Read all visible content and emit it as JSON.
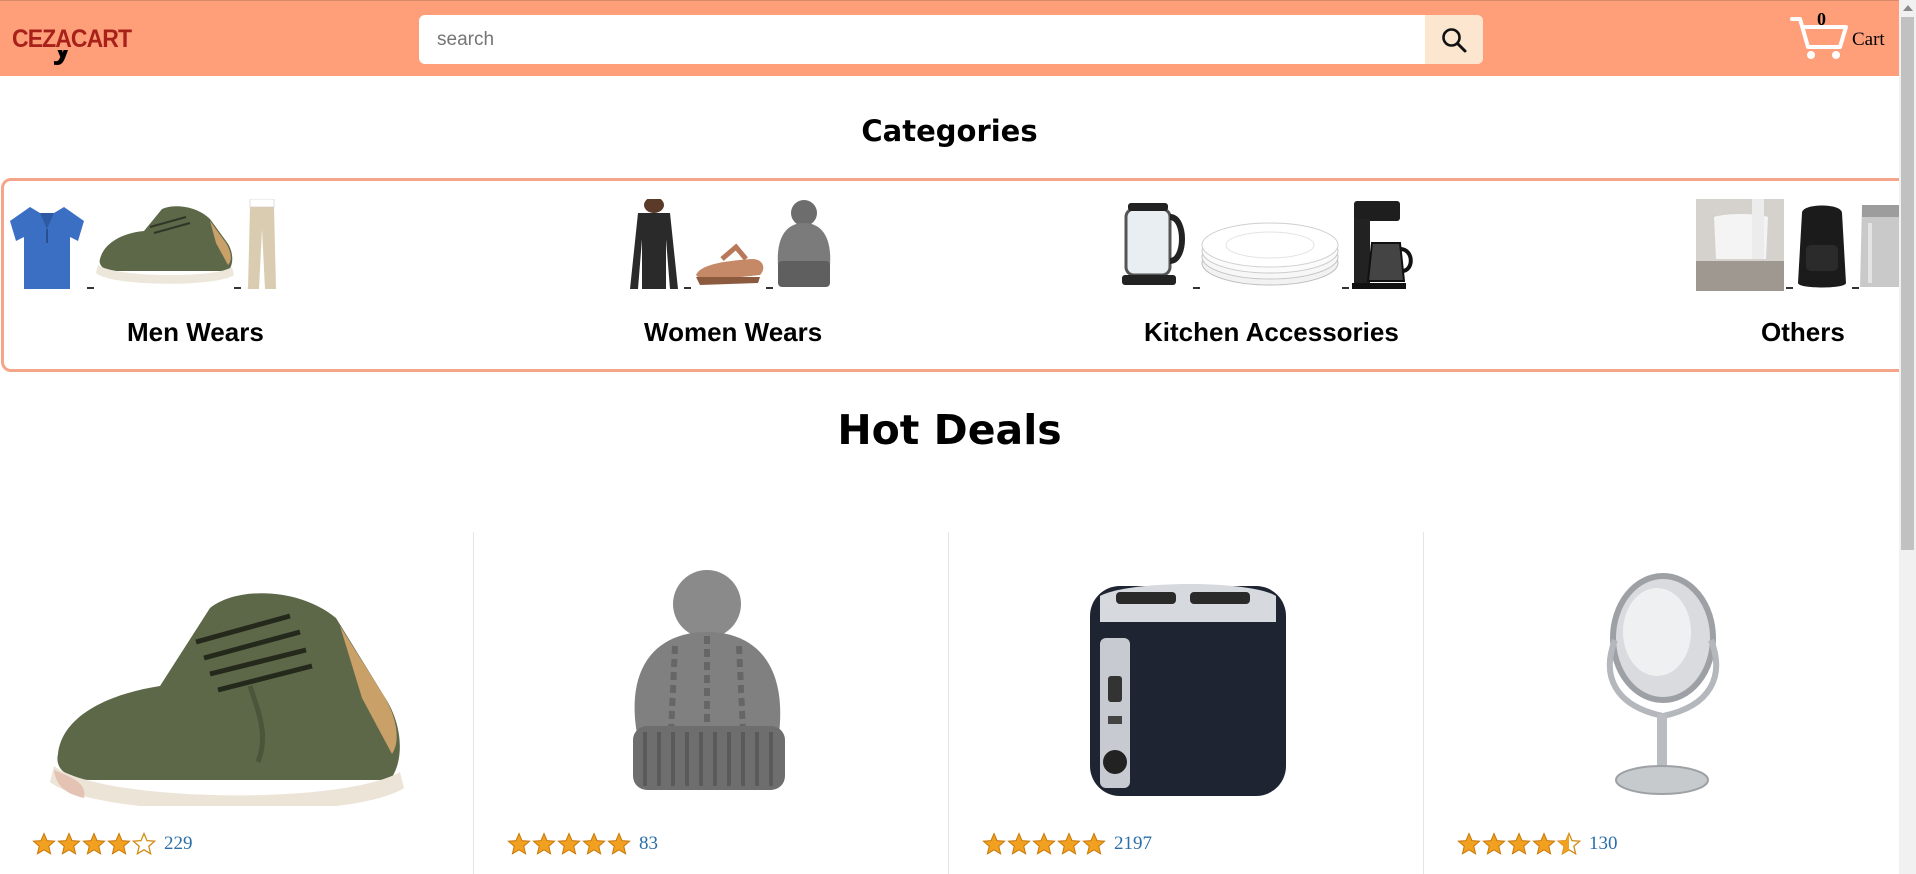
{
  "header": {
    "logo": "CEZACART",
    "search": {
      "placeholder": "search",
      "value": ""
    },
    "cart": {
      "count": "0",
      "label": "Cart"
    }
  },
  "categories": {
    "title": "Categories",
    "items": [
      {
        "label": "Men Wears"
      },
      {
        "label": "Women Wears"
      },
      {
        "label": "Kitchen Accessories"
      },
      {
        "label": "Others"
      }
    ]
  },
  "hot_deals": {
    "title": "Hot Deals",
    "items": [
      {
        "product": "shoe",
        "rating": 3.5,
        "rating_count": "229"
      },
      {
        "product": "knit-beanie",
        "rating": 5,
        "rating_count": "83"
      },
      {
        "product": "toaster",
        "rating": 5,
        "rating_count": "2197"
      },
      {
        "product": "vanity-mirror",
        "rating": 4.5,
        "rating_count": "130"
      }
    ]
  },
  "colors": {
    "header_bg": "#ff9f7a",
    "logo": "#a8201a",
    "category_border": "#f4a58a",
    "star": "#f1a01f",
    "rating_link": "#2b6ea8"
  }
}
